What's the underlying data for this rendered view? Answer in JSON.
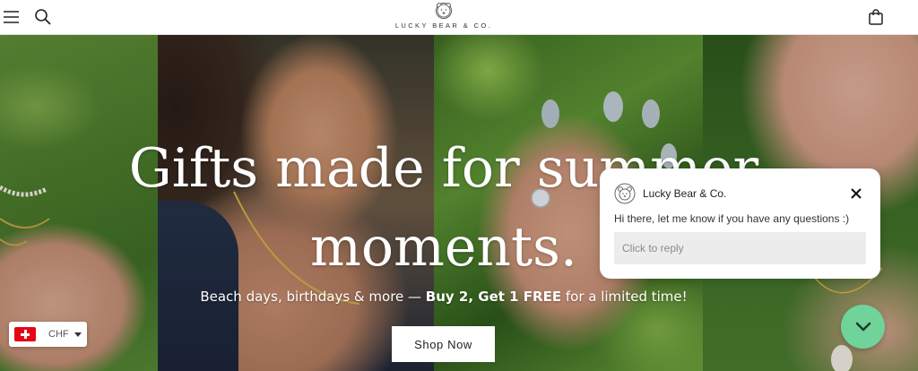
{
  "header": {
    "brand": "LUCKY BEAR & CO."
  },
  "hero": {
    "title_line1": "Gifts made for summer",
    "title_line2": "moments.",
    "subtitle_pre": "Beach days, birthdays & more — ",
    "subtitle_bold": "Buy 2, Get 1 FREE",
    "subtitle_post": " for a limited time!",
    "cta_label": "Shop Now"
  },
  "currency": {
    "code": "CHF",
    "flag": "switzerland-flag"
  },
  "chat": {
    "agent_name": "Lucky Bear & Co.",
    "message": "Hi there, let me know if you have any questions :)",
    "reply_placeholder": "Click to reply"
  },
  "icons": {
    "menu": "menu-icon",
    "search": "search-icon",
    "bag": "shopping-bag-icon",
    "close": "close-icon",
    "toggle": "chevron-down-icon",
    "logo": "bear-logo-icon"
  },
  "colors": {
    "chat_toggle": "#6fd39a",
    "flag_red": "#e30613"
  }
}
